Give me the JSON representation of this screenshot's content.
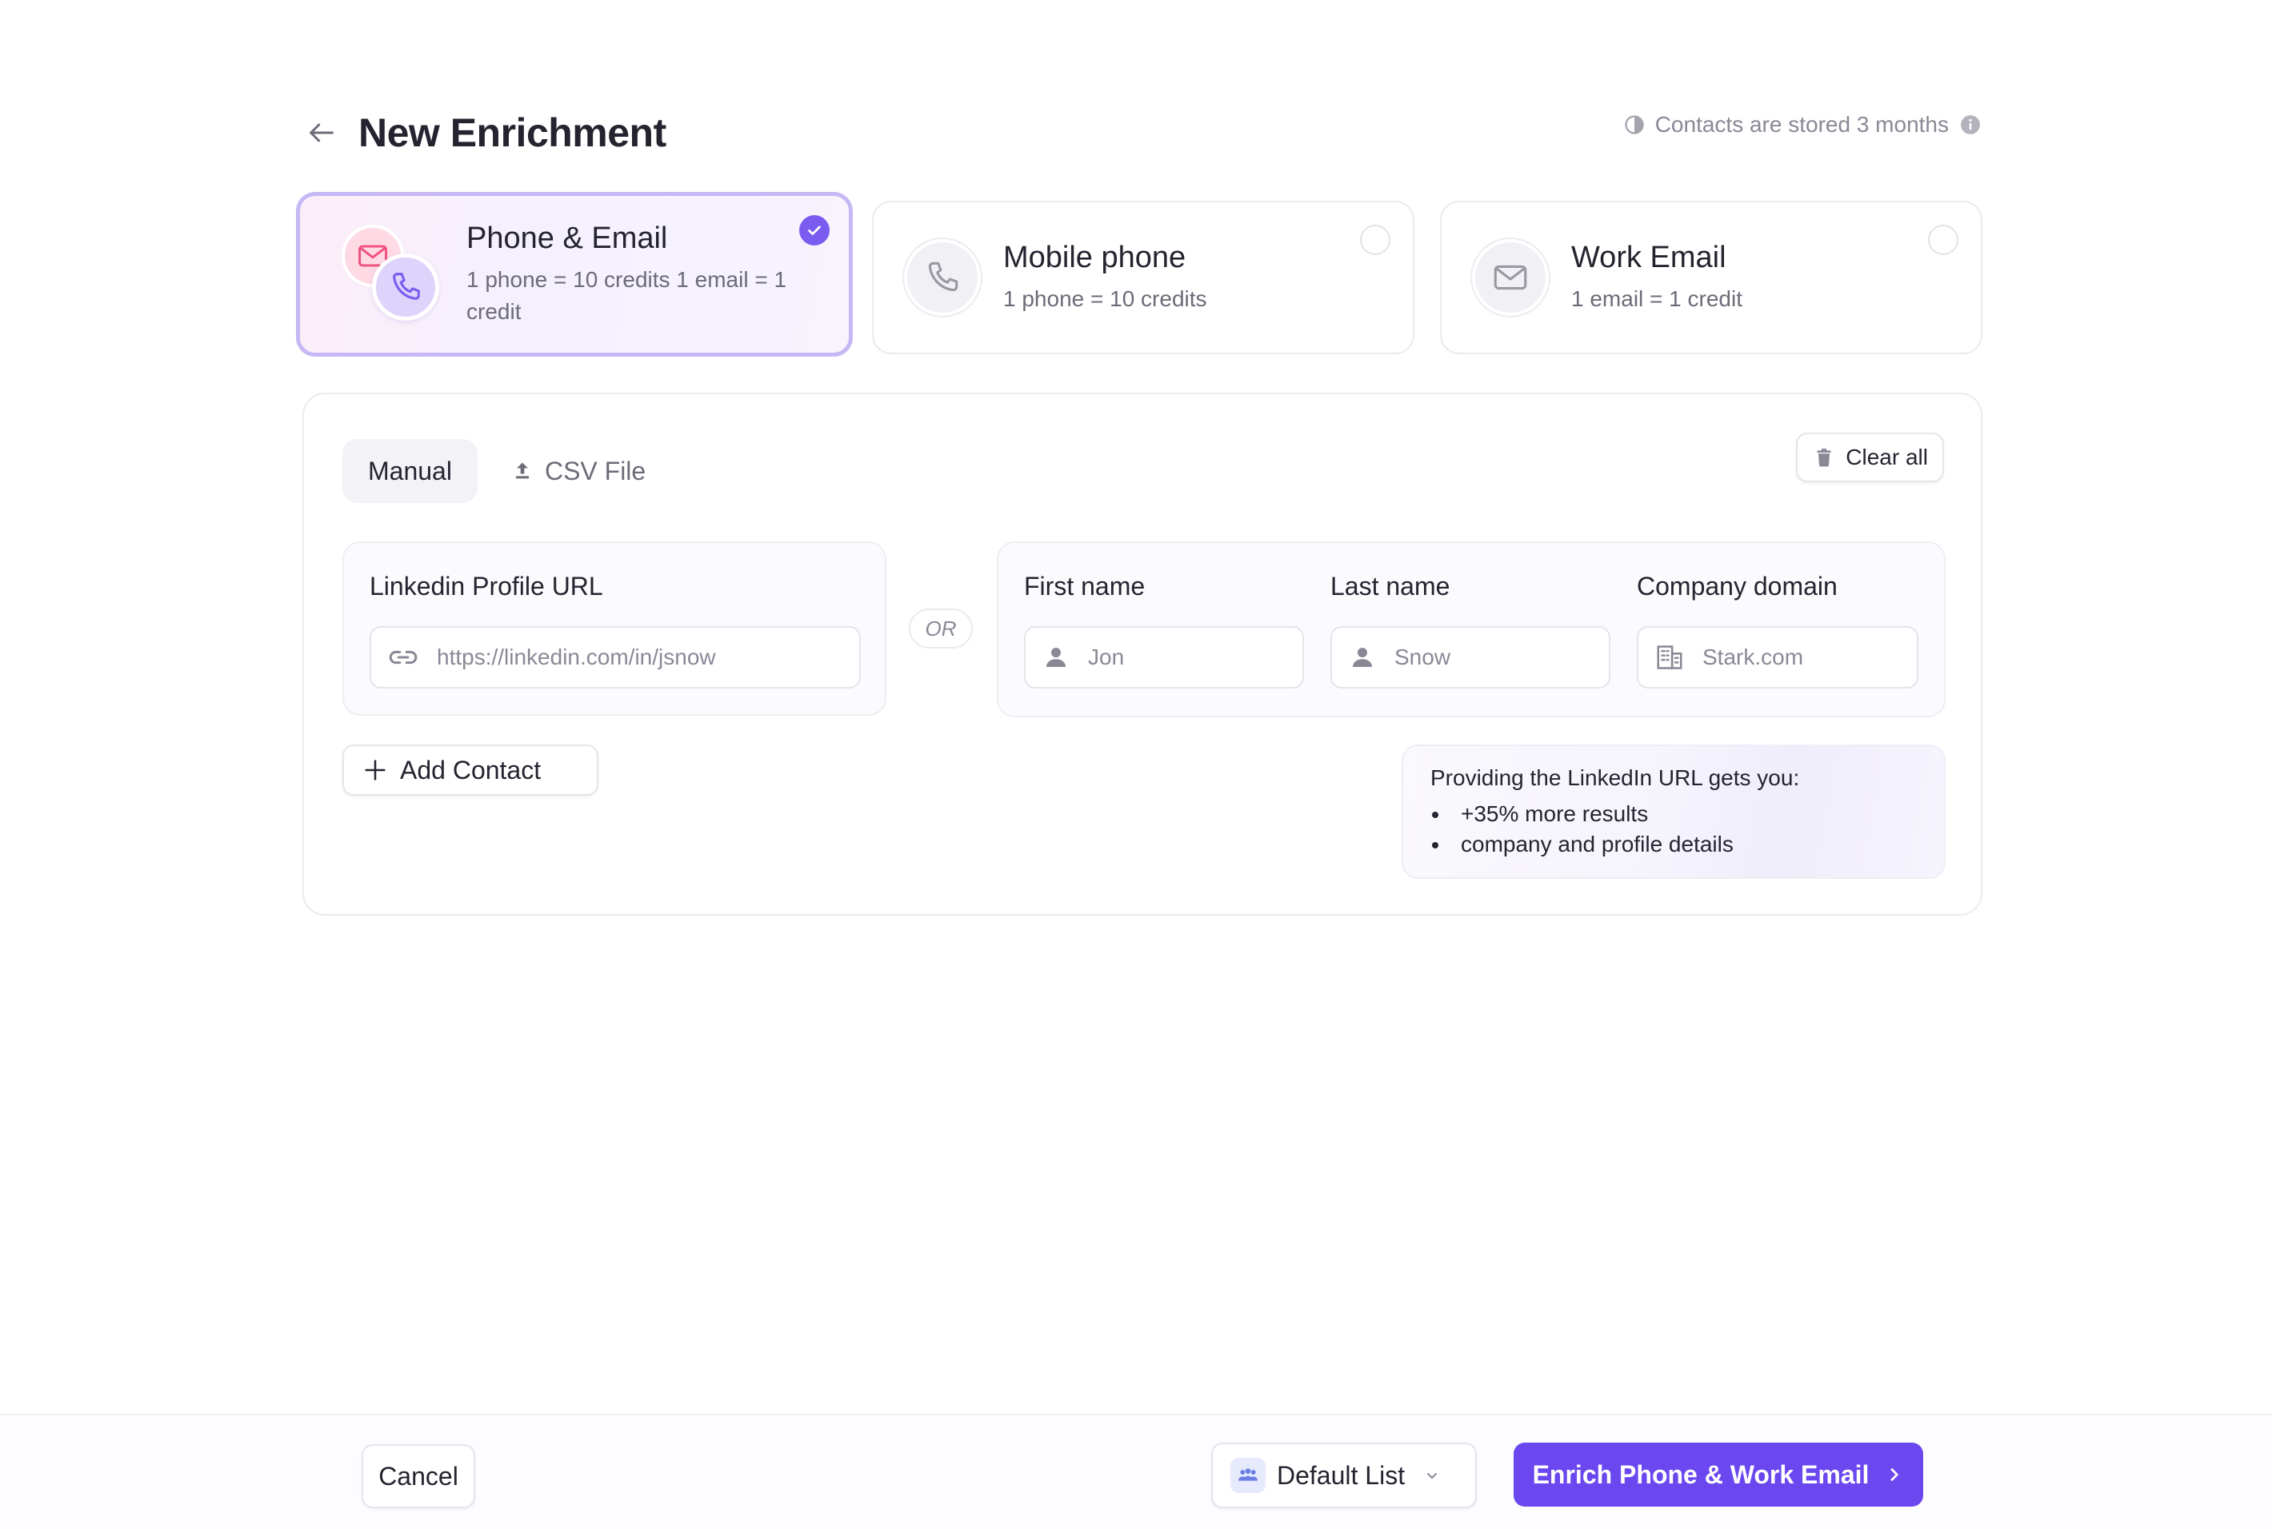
{
  "header": {
    "title": "New Enrichment",
    "storage_note": "Contacts are stored 3 months"
  },
  "options": [
    {
      "title": "Phone & Email",
      "subtitle": "1 phone = 10 credits 1 email = 1 credit",
      "selected": true
    },
    {
      "title": "Mobile phone",
      "subtitle": "1 phone = 10 credits",
      "selected": false
    },
    {
      "title": "Work Email",
      "subtitle": "1 email = 1 credit",
      "selected": false
    }
  ],
  "tabs": {
    "manual": "Manual",
    "csv": "CSV File",
    "active": "Manual"
  },
  "clear_all": "Clear all",
  "form": {
    "linkedin": {
      "label": "Linkedin Profile URL",
      "placeholder": "https://linkedin.com/in/jsnow",
      "value": ""
    },
    "or": "OR",
    "first_name": {
      "label": "First name",
      "placeholder": "Jon",
      "value": ""
    },
    "last_name": {
      "label": "Last name",
      "placeholder": "Snow",
      "value": ""
    },
    "company": {
      "label": "Company domain",
      "placeholder": "Stark.com",
      "value": ""
    }
  },
  "add_contact": "Add Contact",
  "tip": {
    "title": "Providing the LinkedIn URL gets you:",
    "items": [
      "+35% more results",
      "company and profile details"
    ]
  },
  "footer": {
    "cancel": "Cancel",
    "list_selected": "Default List",
    "enrich": "Enrich Phone & Work Email"
  },
  "colors": {
    "accent": "#6a47ee",
    "selected_border": "#c6b8f4",
    "check": "#7a5cf0"
  },
  "icons": {
    "back": "arrow-left-icon",
    "storage": "clock-half-icon",
    "info": "info-icon",
    "phone": "phone-icon",
    "email": "envelope-icon",
    "upload": "upload-icon",
    "trash": "trash-icon",
    "link": "link-icon",
    "person": "person-icon",
    "building": "building-icon",
    "plus": "plus-icon",
    "list": "people-group-icon",
    "chevron_down": "chevron-down-icon",
    "chevron_right": "chevron-right-icon"
  }
}
